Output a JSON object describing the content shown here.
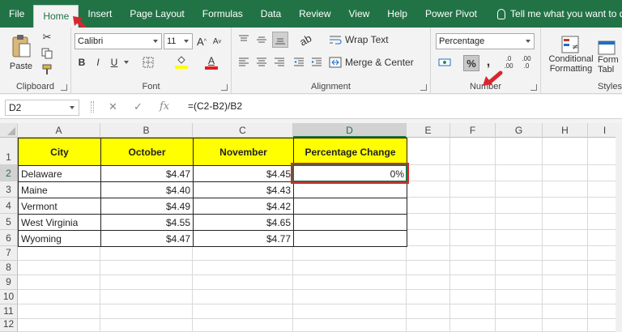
{
  "menu": {
    "tabs": [
      "File",
      "Home",
      "Insert",
      "Page Layout",
      "Formulas",
      "Data",
      "Review",
      "View",
      "Help",
      "Power Pivot"
    ],
    "active_tab": "Home",
    "tell_me": "Tell me what you want to do"
  },
  "ribbon": {
    "clipboard": {
      "paste": "Paste",
      "label": "Clipboard"
    },
    "font": {
      "name": "Calibri",
      "size": "11",
      "grow": "A",
      "shrink": "A",
      "bold": "B",
      "italic": "I",
      "underline": "U",
      "color_letter": "A",
      "label": "Font"
    },
    "alignment": {
      "wrap": "Wrap Text",
      "merge": "Merge & Center",
      "label": "Alignment"
    },
    "number": {
      "format": "Percentage",
      "percent": "%",
      "comma": ",",
      "inc": ".0\n.00",
      "dec": ".00\n.0",
      "label": "Number"
    },
    "styles": {
      "conditional": "Conditional",
      "formatting": "Formatting",
      "table_cut": "Tabl",
      "format_cut": "Form",
      "label": "Styles"
    }
  },
  "formula_bar": {
    "name_box": "D2",
    "formula": "=(C2-B2)/B2"
  },
  "columns": [
    "A",
    "B",
    "C",
    "D",
    "E",
    "F",
    "G",
    "H",
    "I"
  ],
  "rows": [
    "1",
    "2",
    "3",
    "4",
    "5",
    "6",
    "7",
    "8",
    "9",
    "10",
    "11",
    "12"
  ],
  "table": {
    "headers": [
      "City",
      "October",
      "November",
      "Percentage Change"
    ],
    "rows": [
      [
        "Delaware",
        "$4.47",
        "$4.45",
        "0%"
      ],
      [
        "Maine",
        "$4.40",
        "$4.43",
        ""
      ],
      [
        "Vermont",
        "$4.49",
        "$4.42",
        ""
      ],
      [
        "West Virginia",
        "$4.55",
        "$4.65",
        ""
      ],
      [
        "Wyoming",
        "$4.47",
        "$4.77",
        ""
      ]
    ]
  },
  "colors": {
    "excel_green": "#217346",
    "header_fill": "#ffff00",
    "highlight_red": "#d9262c"
  }
}
